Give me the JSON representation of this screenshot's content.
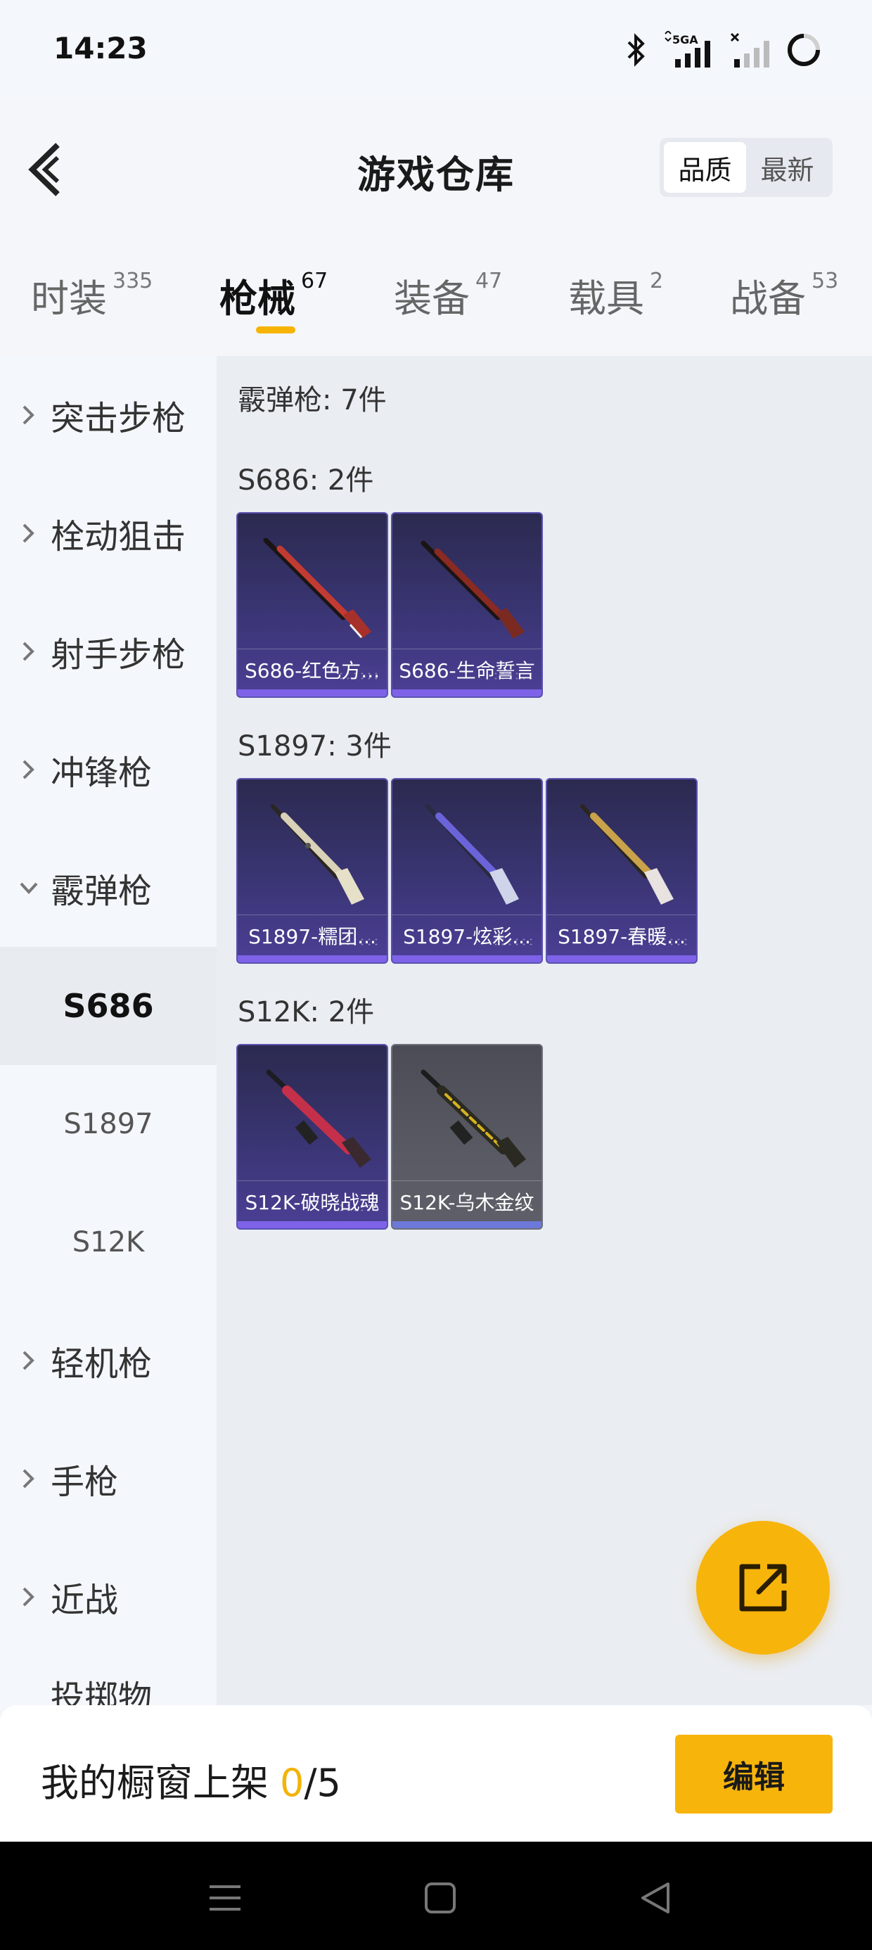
{
  "status_bar": {
    "time": "14:23",
    "network": "5GA"
  },
  "header": {
    "title": "游戏仓库",
    "sort_options": [
      {
        "label": "品质",
        "active": true
      },
      {
        "label": "最新",
        "active": false
      }
    ]
  },
  "tabs": [
    {
      "label": "时装",
      "count": "335"
    },
    {
      "label": "枪械",
      "count": "67",
      "active": true
    },
    {
      "label": "装备",
      "count": "47"
    },
    {
      "label": "载具",
      "count": "2"
    },
    {
      "label": "战备",
      "count": "53"
    }
  ],
  "sidebar": {
    "categories": [
      {
        "label": "突击步枪"
      },
      {
        "label": "栓动狙击"
      },
      {
        "label": "射手步枪"
      },
      {
        "label": "冲锋枪"
      },
      {
        "label": "霰弹枪",
        "expanded": true
      }
    ],
    "subcategories": [
      {
        "label": "S686",
        "active": true
      },
      {
        "label": "S1897"
      },
      {
        "label": "S12K"
      }
    ],
    "more_categories": [
      {
        "label": "轻机枪"
      },
      {
        "label": "手枪"
      },
      {
        "label": "近战"
      }
    ],
    "peek_label": "投掷物"
  },
  "content": {
    "heading": "霰弹枪: 7件",
    "groups": [
      {
        "title": "S686: 2件",
        "items": [
          {
            "name": "S686-红色方...",
            "rarity": "epic",
            "color": "#c23b32"
          },
          {
            "name": "S686-生命誓言",
            "rarity": "epic",
            "color": "#8a2a22"
          }
        ]
      },
      {
        "title": "S1897: 3件",
        "items": [
          {
            "name": "S1897-糯团...",
            "rarity": "epic",
            "color": "#d9d2b8"
          },
          {
            "name": "S1897-炫彩...",
            "rarity": "epic",
            "color": "#6b63d9"
          },
          {
            "name": "S1897-春暖...",
            "rarity": "epic",
            "color": "#c9a24a"
          }
        ]
      },
      {
        "title": "S12K: 2件",
        "items": [
          {
            "name": "S12K-破晓战魂",
            "rarity": "epic",
            "color": "#c4304a"
          },
          {
            "name": "S12K-乌木金纹",
            "rarity": "rare",
            "color": "#d8b21e"
          }
        ]
      }
    ]
  },
  "bottom": {
    "showcase_label": "我的橱窗上架",
    "showcase_used": "0",
    "showcase_total": "/5",
    "edit_label": "编辑"
  },
  "colors": {
    "accent": "#f7b40b",
    "epic": "#4b3f95",
    "rare": "#595a63"
  }
}
